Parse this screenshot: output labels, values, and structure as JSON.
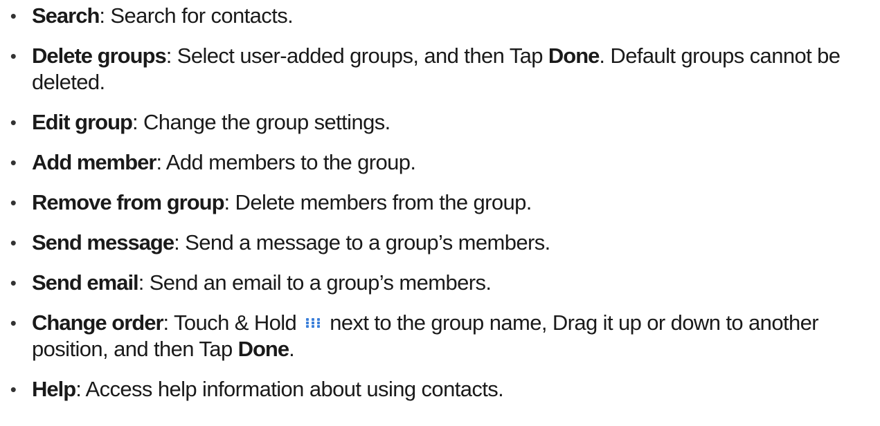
{
  "items": [
    {
      "term": "Search",
      "text": ": Search for contacts."
    },
    {
      "term": "Delete groups",
      "text": ": Select user-added groups, and then Tap ",
      "term2": "Done",
      "text2": ". Default groups cannot be deleted."
    },
    {
      "term": "Edit group",
      "text": ": Change the group settings."
    },
    {
      "term": "Add member",
      "text": ": Add members to the group."
    },
    {
      "term": "Remove from group",
      "text": ": Delete members from the group."
    },
    {
      "term": "Send message",
      "text": ": Send a message to a group’s members."
    },
    {
      "term": "Send email",
      "text": ": Send an email to a group’s members."
    },
    {
      "term": "Change order",
      "text": ": Touch & Hold ",
      "icon": "drag-handle-icon",
      "text_after_icon": " next to the group name, Drag it up or down to another position, and then Tap ",
      "term2": "Done",
      "text2": "."
    },
    {
      "term": "Help",
      "text": ": Access help information about using contacts."
    }
  ],
  "colors": {
    "text": "#1a1a1a",
    "icon_accent": "#3b7fd9"
  }
}
